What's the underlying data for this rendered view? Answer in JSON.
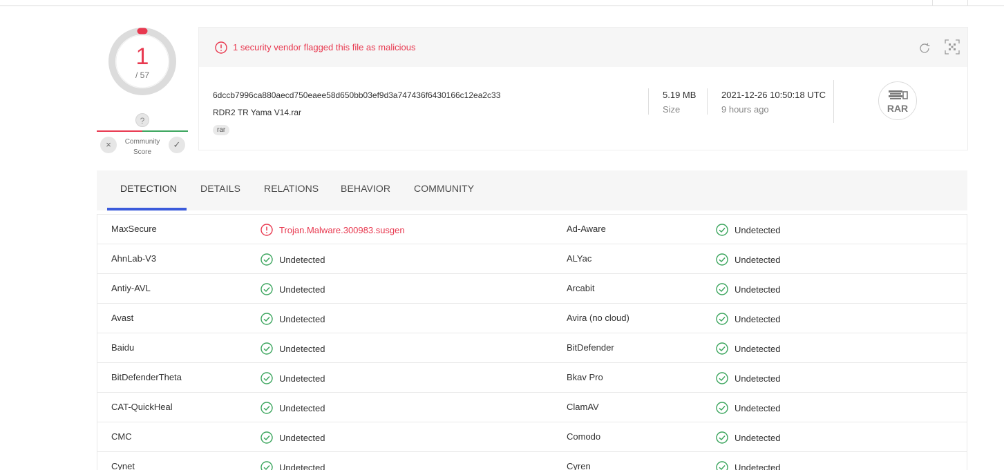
{
  "score": {
    "detections": "1",
    "total": "/ 57",
    "help_glyph": "?",
    "community_label_line1": "Community",
    "community_label_line2": "Score",
    "downvote_glyph": "×",
    "upvote_glyph": "✓",
    "colors": {
      "malicious": "#e8384f",
      "clean": "#3ba55d"
    }
  },
  "file": {
    "alert": "1 security vendor flagged this file as malicious",
    "hash": "6dccb7996ca880aecd750eaee58d650bb03ef9d3a747436f6430166c12ea2c33",
    "name": "RDR2 TR Yama V14.rar",
    "tag": "rar",
    "size_value": "5.19 MB",
    "size_label": "Size",
    "date_value": "2021-12-26 10:50:18 UTC",
    "date_label": "9 hours ago",
    "type_badge": "RAR",
    "icons": [
      "alert-circle-icon",
      "reload-icon",
      "qr-scan-icon",
      "rar-file-icon"
    ]
  },
  "tabs": [
    {
      "label": "DETECTION",
      "active": true
    },
    {
      "label": "DETAILS",
      "active": false
    },
    {
      "label": "RELATIONS",
      "active": false
    },
    {
      "label": "BEHAVIOR",
      "active": false
    },
    {
      "label": "COMMUNITY",
      "active": false
    }
  ],
  "detections": [
    {
      "v1": "MaxSecure",
      "r1": "Trojan.Malware.300983.susgen",
      "m1": true,
      "v2": "Ad-Aware",
      "r2": "Undetected",
      "m2": false
    },
    {
      "v1": "AhnLab-V3",
      "r1": "Undetected",
      "m1": false,
      "v2": "ALYac",
      "r2": "Undetected",
      "m2": false
    },
    {
      "v1": "Antiy-AVL",
      "r1": "Undetected",
      "m1": false,
      "v2": "Arcabit",
      "r2": "Undetected",
      "m2": false
    },
    {
      "v1": "Avast",
      "r1": "Undetected",
      "m1": false,
      "v2": "Avira (no cloud)",
      "r2": "Undetected",
      "m2": false
    },
    {
      "v1": "Baidu",
      "r1": "Undetected",
      "m1": false,
      "v2": "BitDefender",
      "r2": "Undetected",
      "m2": false
    },
    {
      "v1": "BitDefenderTheta",
      "r1": "Undetected",
      "m1": false,
      "v2": "Bkav Pro",
      "r2": "Undetected",
      "m2": false
    },
    {
      "v1": "CAT-QuickHeal",
      "r1": "Undetected",
      "m1": false,
      "v2": "ClamAV",
      "r2": "Undetected",
      "m2": false
    },
    {
      "v1": "CMC",
      "r1": "Undetected",
      "m1": false,
      "v2": "Comodo",
      "r2": "Undetected",
      "m2": false
    },
    {
      "v1": "Cynet",
      "r1": "Undetected",
      "m1": false,
      "v2": "Cyren",
      "r2": "Undetected",
      "m2": false
    }
  ]
}
